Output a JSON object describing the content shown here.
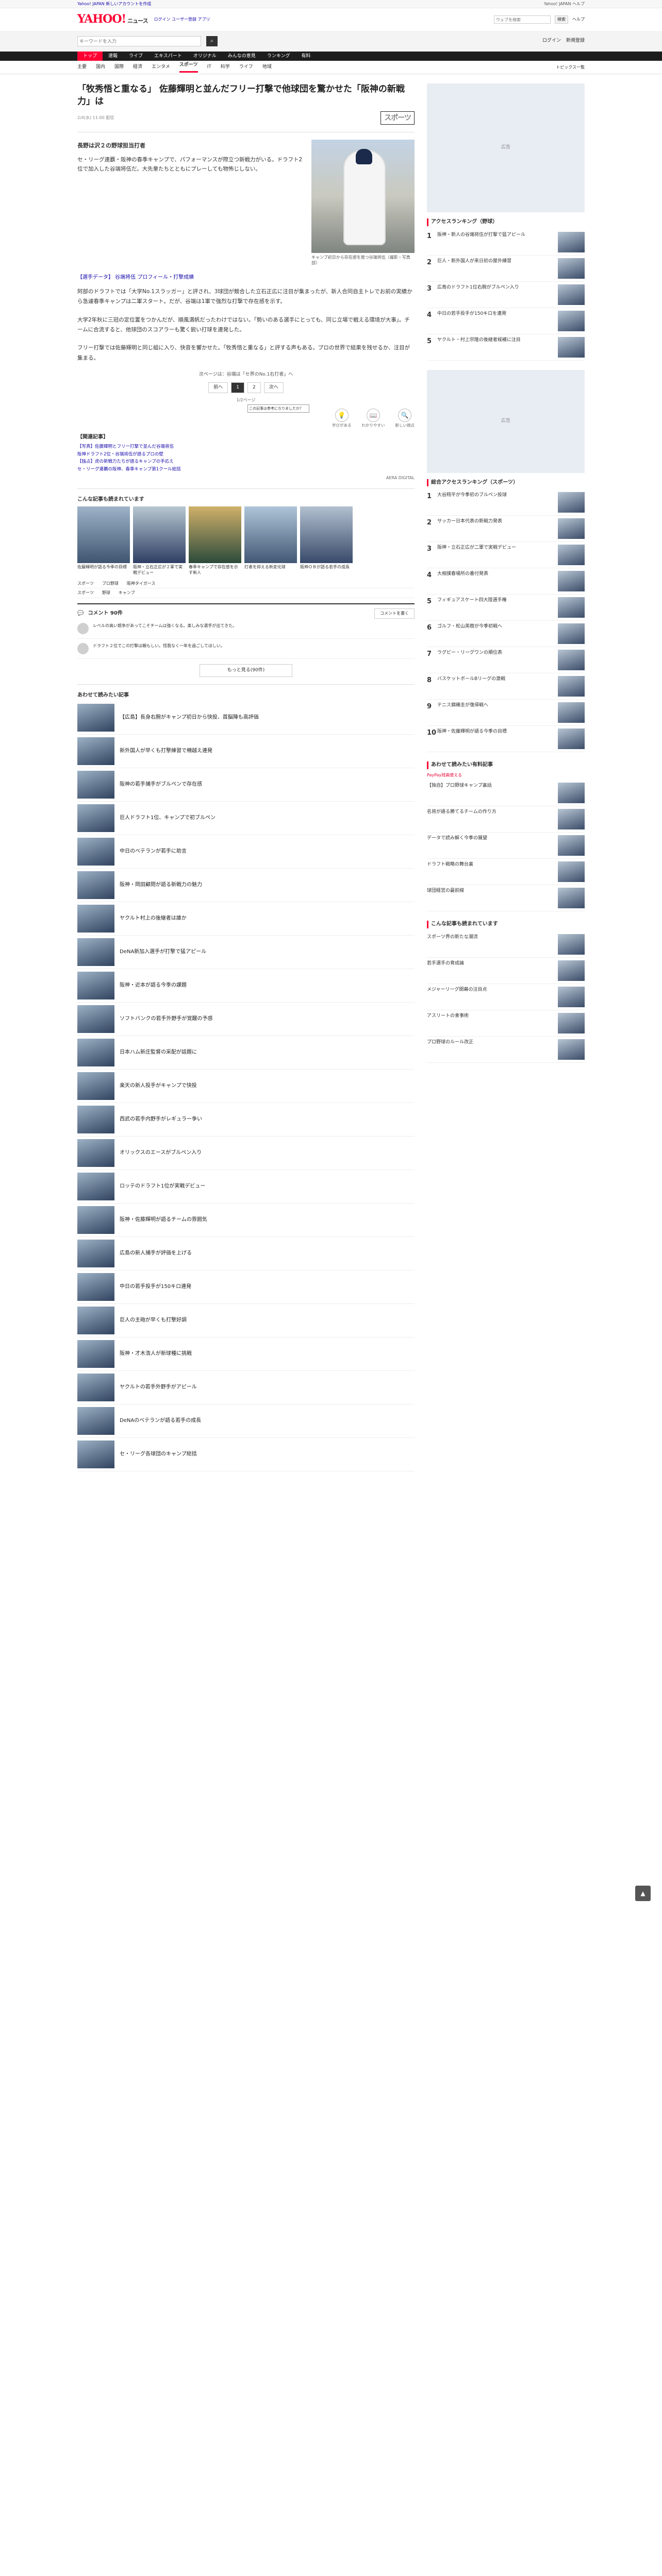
{
  "top": {
    "promo": "Yahoo! JAPAN 新しいアカウントを作成",
    "right": "Yahoo! JAPAN ヘルプ"
  },
  "header": {
    "logo": "YAHOO!",
    "logo_sub": "ニュース",
    "links": "ログイン ユーザー登録 アプリ",
    "search_placeholder": "ウェブを検索",
    "search_btn": "検索",
    "menu": "ヘルプ"
  },
  "searchbar": {
    "placeholder": "キーワードを入力",
    "right": [
      "ログイン",
      "新規登録"
    ]
  },
  "nav": [
    "トップ",
    "速報",
    "ライブ",
    "エキスパート",
    "オリジナル",
    "みんなの意見",
    "ランキング",
    "有料"
  ],
  "subnav": [
    "主要",
    "国内",
    "国際",
    "経済",
    "エンタメ",
    "スポーツ",
    "IT",
    "科学",
    "ライフ",
    "地域"
  ],
  "subnav_more": "トピックス一覧",
  "article": {
    "title": "「牧秀悟と重なる」 佐藤輝明と並んだフリー打撃で他球団を驚かせた「阪神の新戦力」は",
    "date": "2/4(水) 11:00 配信",
    "brand": "スポーツ",
    "subhead": "長野は沢２の野球担当打者",
    "lede": "セ・リーグ連覇・阪神の春季キャンプで、パフォーマンスが際立つ新戦力がいる。ドラフト2位で加入した谷端将伍だ。大先輩たちとともにプレーしても物怖じしない。",
    "photo_caption": "キャンプ初日から存在感を放つ谷端将伍（撮影・写真部）",
    "related": "【選手データ】 谷端将伍 プロフィール・打撃成績",
    "paragraphs": [
      "阿部のドラフトでは「大学No.1スラッガー」と評され、3球団が競合した立石正広に注目が集まったが、新人合同自主トレでお前の実績から急遽春季キャンプは二軍スタート。だが、谷端は1軍で強烈な打撃で存在感を示す。",
      "大学2年秋に三冠の定位置をつかんだが、順風満帆だったわけではない。「勢いのある選手にとっても、同じ立場で戦える環境が大事」。チームに合流すると、他球団のスコアラーも驚く鋭い打球を連発した。",
      "フリー打撃では佐藤輝明と同じ組に入り、快音を響かせた。「牧秀悟と重なる」と評する声もある。プロの世界で結果を残せるか、注目が集まる。"
    ],
    "page_note": "次ページは：谷端は「セ界のNo.1右打者」へ",
    "pages": [
      "前へ",
      "1",
      "2",
      "次へ"
    ],
    "page_count": "1/2ページ",
    "reactions": [
      {
        "icon": "💡",
        "label": "学びがある"
      },
      {
        "icon": "📖",
        "label": "わかりやすい"
      },
      {
        "icon": "🔍",
        "label": "新しい視点"
      }
    ],
    "tooltip": "この記事は参考になりましたか？",
    "related_h": "【関連記事】",
    "related_links": [
      "【写真】佐藤輝明とフリー打撃で並んだ谷端将伍",
      "阪神ドラフト2位・谷端将伍が語るプロの壁",
      "【独占】虎の新戦力たちが語るキャンプの手応え",
      "セ・リーグ連覇の阪神、春季キャンプ第1クール総括"
    ],
    "source": "AERA DIGITAL"
  },
  "recommend": {
    "heading": "こんな記事も読まれています",
    "items": [
      "佐藤輝明が語る今季の目標",
      "阪神・立石正広が２軍で実戦デビュー",
      "春季キャンプで存在感を示す新人",
      "打者を抑える新変化球",
      "阪神ＯＢが語る若手の成長"
    ]
  },
  "tags": [
    [
      "スポーツ",
      "プロ野球",
      "阪神タイガース"
    ],
    [
      "スポーツ",
      "野球",
      "キャンプ"
    ]
  ],
  "comments": {
    "heading": "コメント 90件",
    "write": "コメントを書く",
    "items": [
      "レベルの高い競争があってこそチームは強くなる。楽しみな選手が出てきた。",
      "ドラフト２位でこの打撃は頼もしい。怪我なく一年を過ごしてほしい。"
    ],
    "more": "もっと見る(90件)"
  },
  "also_read": {
    "heading": "あわせて読みたい記事",
    "items": [
      "【広島】長身右腕がキャンプ初日から快投、首脳陣も高評価",
      "新外国人が早くも打撃練習で柵越え連発",
      "阪神の若手捕手がブルペンで存在感",
      "巨人ドラフト1位、キャンプで初ブルペン",
      "中日のベテランが若手に助言",
      "阪神・岡田顧問が語る新戦力の魅力",
      "ヤクルト村上の後継者は誰か",
      "DeNA新加入選手が打撃で猛アピール",
      "阪神・近本が語る今季の課題",
      "ソフトバンクの若手外野手が覚醒の予感",
      "日本ハム新庄監督の采配が話題に",
      "楽天の新人投手がキャンプで快投",
      "西武の若手内野手がレギュラー争い",
      "オリックスのエースがブルペン入り",
      "ロッテのドラフト1位が実戦デビュー",
      "阪神・佐藤輝明が語るチームの雰囲気",
      "広島の新人捕手が評価を上げる",
      "中日の若手投手が150キロ連発",
      "巨人の主砲が早くも打撃好調",
      "阪神・才木浩人が新球種に挑戦",
      "ヤクルトの若手外野手がアピール",
      "DeNAのベテランが語る若手の成長",
      "セ・リーグ各球団のキャンプ総括"
    ]
  },
  "sidebar": {
    "access_h": "アクセスランキング（野球）",
    "access": [
      "阪神・新人の谷端将伍が打撃で猛アピール",
      "巨人・新外国人が来日初の屋外練習",
      "広島のドラフト1位右腕がブルペン入り",
      "中日の若手投手が150キロを連発",
      "ヤクルト・村上宗隆の後継者候補に注目"
    ],
    "ad_label": "広告",
    "general_h": "総合アクセスランキング（スポーツ）",
    "general": [
      "大谷翔平が今季初のブルペン投球",
      "サッカー日本代表の新戦力発表",
      "阪神・立石正広が二軍で実戦デビュー",
      "大相撲春場所の番付発表",
      "フィギュアスケート四大陸選手権",
      "ゴルフ・松山英樹が今季初戦へ",
      "ラグビー・リーグワンの順位表",
      "バスケットボールBリーグの激戦",
      "テニス錦織圭が復帰戦へ",
      "阪神・佐藤輝明が語る今季の目標"
    ],
    "pay_h": "あわせて読みたい有料記事",
    "pay_badge": "PayPay残高使える",
    "pay": [
      "【独自】プロ野球キャンプ裏話",
      "名将が語る勝てるチームの作り方",
      "データで読み解く今季の展望",
      "ドラフト戦略の舞台裏",
      "球団経営の最前線"
    ],
    "more_h": "こんな記事も読まれています",
    "more": [
      "スポーツ界の新たな潮流",
      "若手選手の育成論",
      "メジャーリーグ開幕の注目点",
      "アスリートの食事術",
      "プロ野球のルール改正"
    ]
  }
}
